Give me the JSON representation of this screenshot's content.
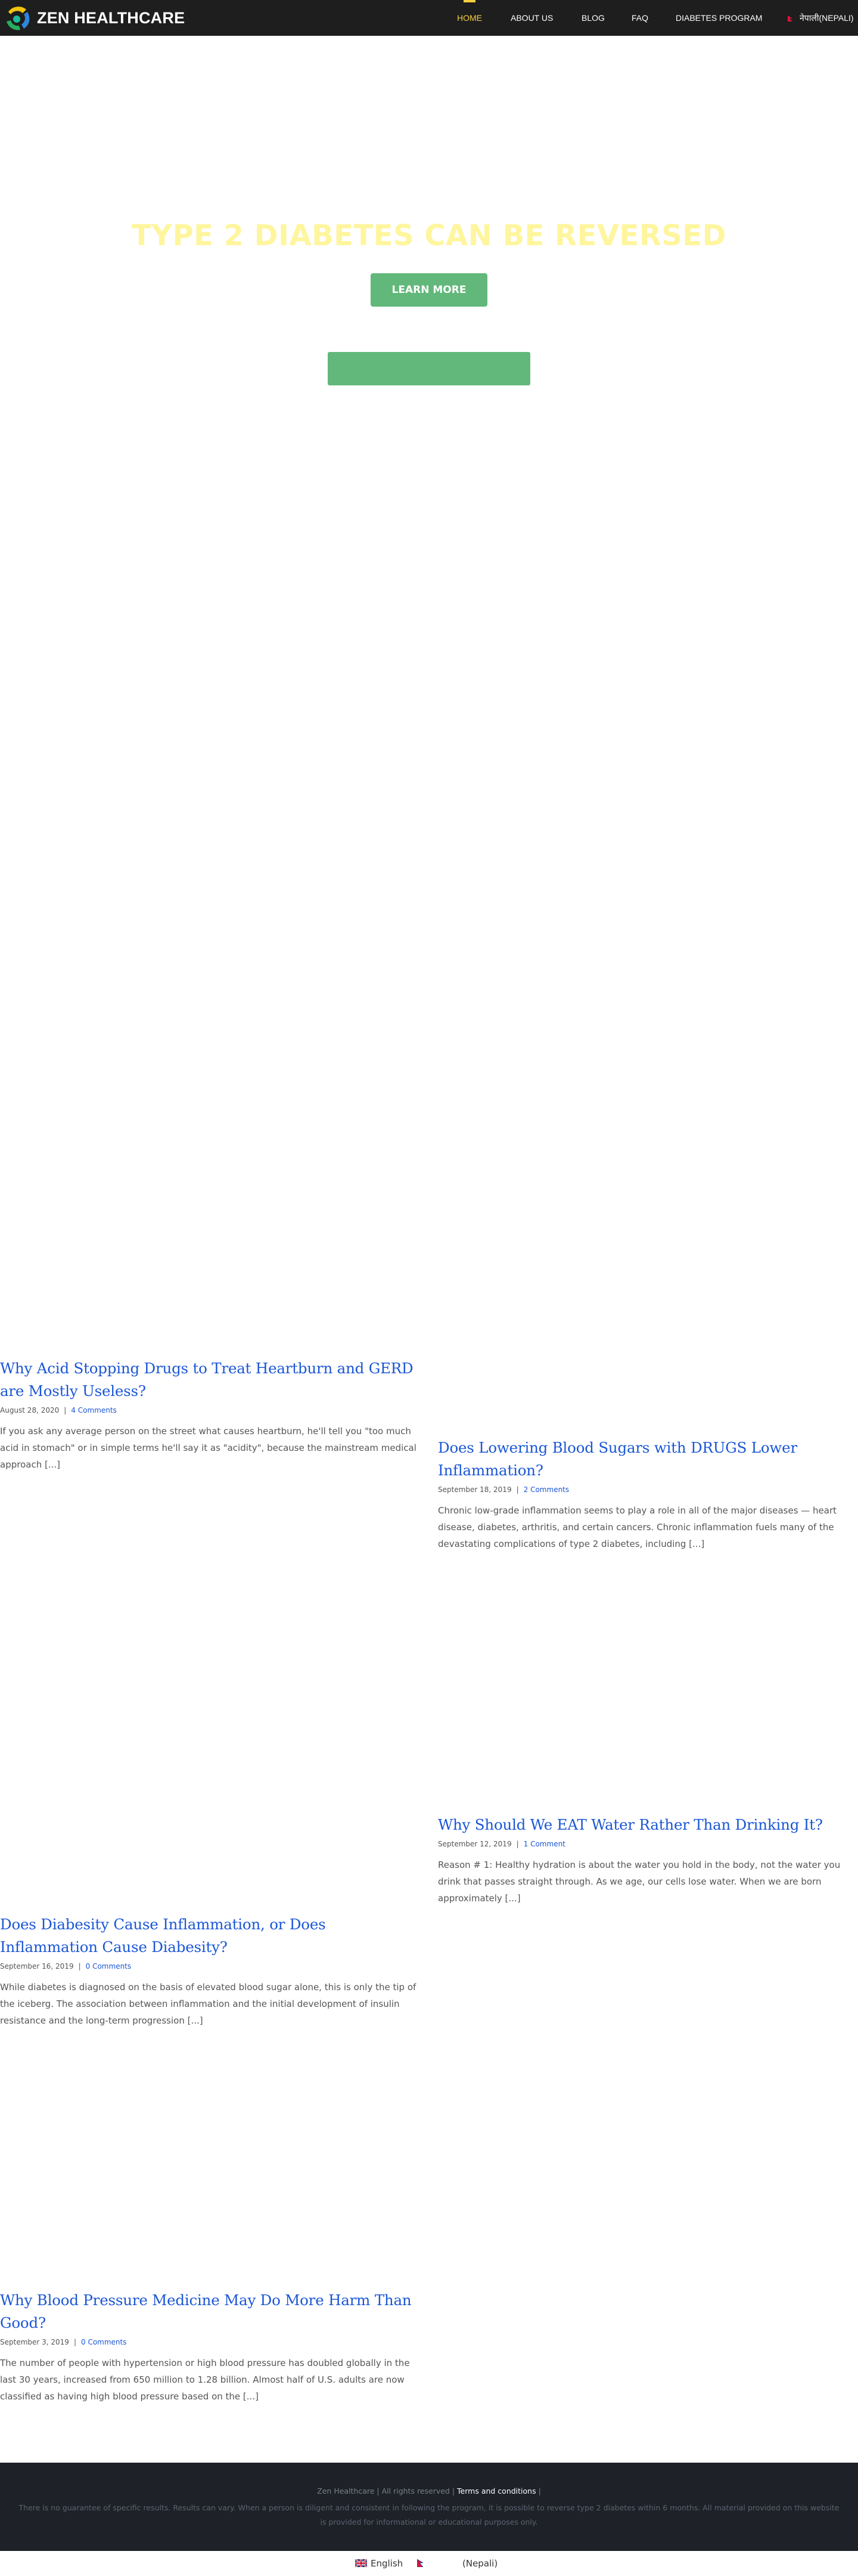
{
  "header": {
    "brand": "ZEN HEALTHCARE",
    "nav": [
      {
        "label": "HOME",
        "active": true
      },
      {
        "label": "ABOUT US",
        "active": false
      },
      {
        "label": "BLOG",
        "active": false
      },
      {
        "label": "FAQ",
        "active": false
      },
      {
        "label": "DIABETES PROGRAM",
        "active": false
      }
    ],
    "language_label": "नेपाली(Nepali)"
  },
  "hero": {
    "title": "TYPE 2 DIABETES CAN BE REVERSED",
    "cta_label": "LEARN MORE"
  },
  "posts": [
    {
      "title": "Why Acid Stopping Drugs to Treat Heartburn and GERD are Mostly Useless?",
      "date": "August 28, 2020",
      "comments": "4 Comments",
      "excerpt": "If you ask any average person on the street what causes heartburn, he'll tell you \"too much acid in stomach\" or in simple terms he'll say it as \"acidity\", because the mainstream medical approach [...]"
    },
    {
      "title": "Does Lowering Blood Sugars with DRUGS Lower Inflammation?",
      "date": "September 18, 2019",
      "comments": "2 Comments",
      "excerpt": "Chronic low-grade inflammation seems to play a role in all of the major diseases — heart disease, diabetes, arthritis, and certain cancers. Chronic inflammation fuels many of the devastating complications of type 2 diabetes, including [...]"
    },
    {
      "title": "Why Should We EAT Water Rather Than Drinking It?",
      "date": "September 12, 2019",
      "comments": "1 Comment",
      "excerpt": "Reason # 1: Healthy hydration is about the water you hold in the body, not the water you drink that passes straight through. As we age, our cells lose water. When we are born approximately [...]"
    },
    {
      "title": "Does Diabesity Cause Inflammation, or Does Inflammation Cause Diabesity?",
      "date": "September 16, 2019",
      "comments": "0 Comments",
      "excerpt": "While diabetes is diagnosed on the basis of elevated blood sugar alone, this is only the tip of the iceberg. The association between inflammation and the initial development of insulin resistance and the long-term progression [...]"
    },
    {
      "title": "Why Blood Pressure Medicine May Do More Harm Than Good?",
      "date": "September 3, 2019",
      "comments": "0 Comments",
      "excerpt": "The number of people with hypertension or high blood pressure has doubled globally in the last 30 years, increased from 650 million to 1.28 billion. Almost half of U.S. adults are now classified as having high blood pressure based on the [...]"
    }
  ],
  "footer": {
    "copyright": "Zen Healthcare | All rights reserved |",
    "terms_link": "Terms and conditions",
    "terms_suffix": "|",
    "disclaimer": "There is no guarantee of specific results. Results can vary. When a person is diligent and consistent in following the program, it is possible to reverse type 2 diabetes within 6 months. All material provided on this website is provided for informational or educational purposes only."
  },
  "language_switcher": {
    "english": "English",
    "nepali": "(Nepali)"
  },
  "colors": {
    "header_bg": "#1e1e1e",
    "nav_active": "#f4d03f",
    "hero_title": "#fff59d",
    "cta_green": "#62b87a",
    "link_blue": "#1a56d6",
    "footer_bg": "#1e2128"
  }
}
